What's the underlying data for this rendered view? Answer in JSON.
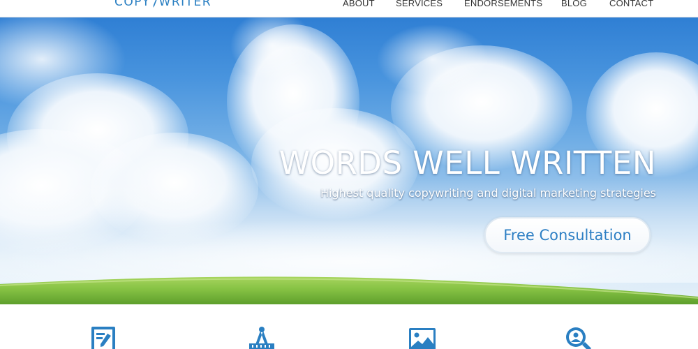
{
  "header": {
    "logo_text": "COPYWRITER",
    "nav": [
      {
        "label": "ABOUT"
      },
      {
        "label": "SERVICES"
      },
      {
        "label": "ENDORSEMENTS"
      },
      {
        "label": "BLOG"
      },
      {
        "label": "CONTACT"
      }
    ]
  },
  "hero": {
    "title": "WORDS WELL WRITTEN",
    "subtitle": "Highest quality copywriting and digital marketing strategies",
    "cta_label": "Free Consultation"
  },
  "features": {
    "icons": [
      "document-edit-icon",
      "blueprint-compass-icon",
      "image-icon",
      "search-user-icon"
    ]
  },
  "colors": {
    "accent": "#2a7fc2",
    "nav_text": "#333333",
    "sky_top": "#2f7fd4",
    "grass": "#86c244"
  }
}
